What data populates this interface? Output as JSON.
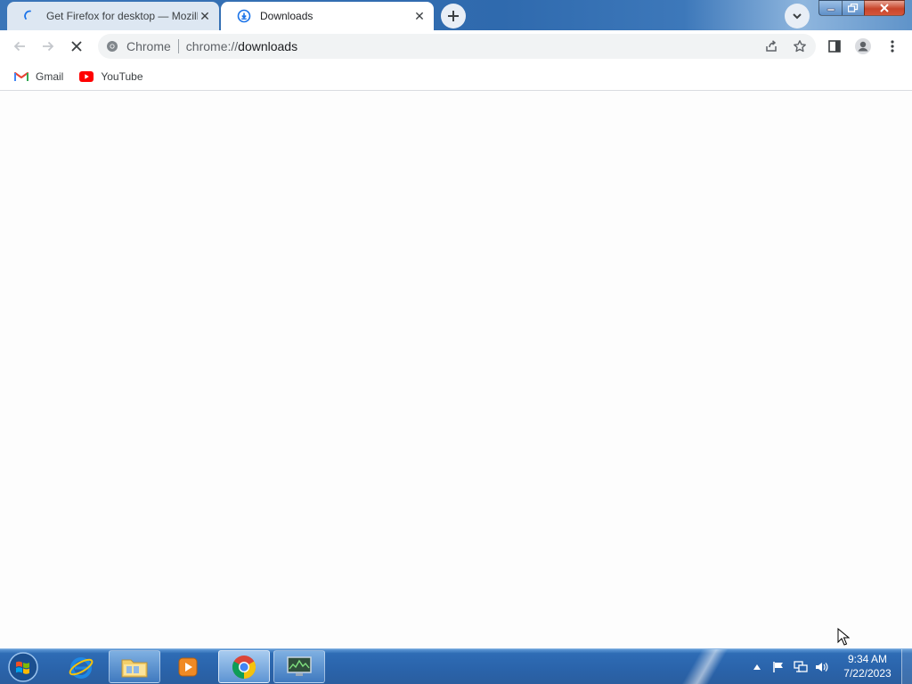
{
  "window": {
    "tabs": [
      {
        "title": "Get Firefox for desktop — Mozilla",
        "active": false
      },
      {
        "title": "Downloads",
        "active": true
      }
    ]
  },
  "toolbar": {
    "omnibox": {
      "chip_label": "Chrome",
      "url_scheme": "chrome://",
      "url_host": "downloads"
    }
  },
  "bookmarks": [
    {
      "label": "Gmail",
      "icon": "gmail-icon"
    },
    {
      "label": "YouTube",
      "icon": "youtube-icon"
    }
  ],
  "taskbar": {
    "apps": [
      "start-orb",
      "internet-explorer",
      "windows-explorer",
      "media-player",
      "chrome",
      "task-manager"
    ],
    "clock": {
      "time": "9:34 AM",
      "date": "7/22/2023"
    }
  },
  "colors": {
    "tabstrip": "#3a75b8",
    "gmail_red": "#ea4335",
    "youtube_red": "#ff0000",
    "accent_blue": "#1a73e8"
  }
}
